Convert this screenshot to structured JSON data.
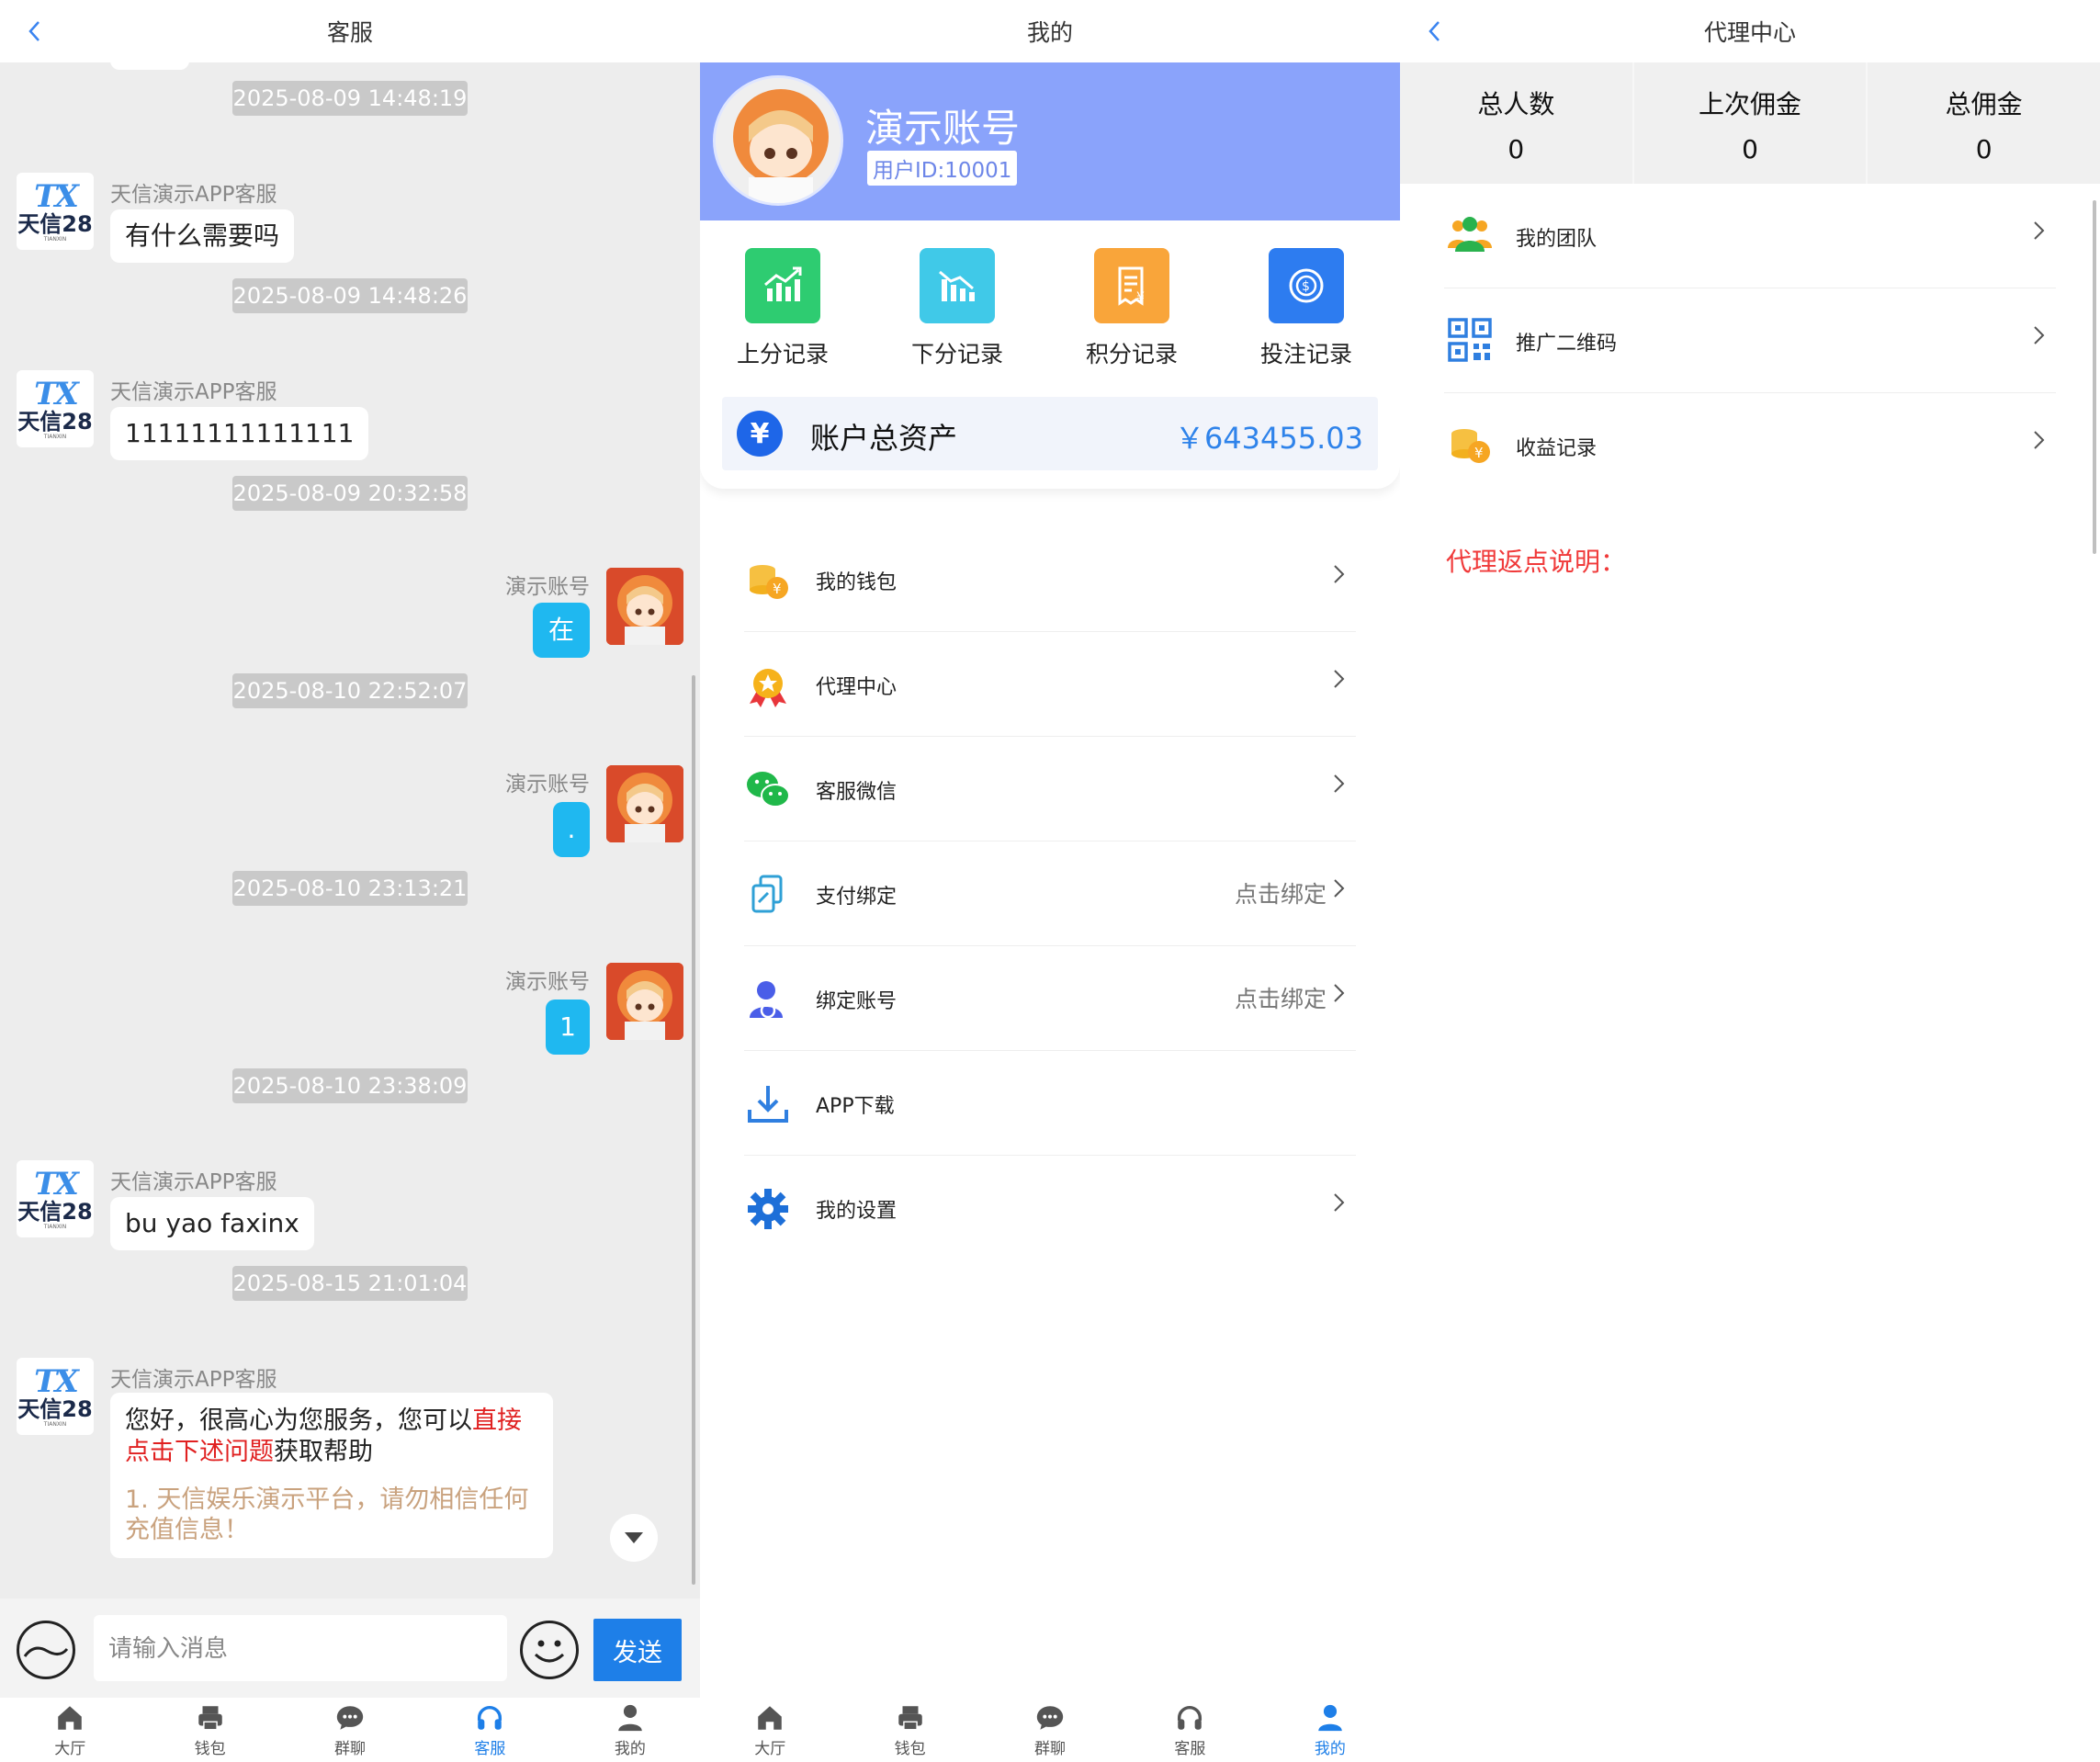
{
  "chat": {
    "title": "客服",
    "service_name": "天信演示APP客服",
    "avatar_tx": "TX",
    "avatar_brand": "天信28",
    "avatar_tiny": "TIANXIN",
    "my_name": "演示账号",
    "timestamps": [
      "2025-08-09 14:48:19",
      "2025-08-09 14:48:26",
      "2025-08-09 20:32:58",
      "2025-08-10 22:52:07",
      "2025-08-10 23:13:21",
      "2025-08-10 23:38:09",
      "2025-08-15 21:01:04"
    ],
    "messages": {
      "m1": "有什么需要吗",
      "m2": "11111111111111",
      "m3": "在",
      "m4": ".",
      "m5": "1",
      "m6": "bu yao faxinx"
    },
    "welcome": {
      "part1": "您好，很高心为您服务，您可以",
      "part_red": "直接点击下述问题",
      "part2": "获取帮助",
      "faq1": "1. 天信娱乐演示平台，请勿相信任何充值信息！"
    },
    "input_placeholder": "请输入消息",
    "send_label": "发送"
  },
  "tabs": [
    "大厅",
    "钱包",
    "群聊",
    "客服",
    "我的"
  ],
  "profile": {
    "title": "我的",
    "user_name": "演示账号",
    "user_id": "用户ID:10001",
    "quick": [
      "上分记录",
      "下分记录",
      "积分记录",
      "投注记录"
    ],
    "asset_label": "账户总资产",
    "asset_value": "￥643455.03",
    "menu": [
      {
        "label": "我的钱包",
        "right": ""
      },
      {
        "label": "代理中心",
        "right": ""
      },
      {
        "label": "客服微信",
        "right": ""
      },
      {
        "label": "支付绑定",
        "right": "点击绑定"
      },
      {
        "label": "绑定账号",
        "right": "点击绑定"
      },
      {
        "label": "APP下载",
        "right": ""
      },
      {
        "label": "我的设置",
        "right": ""
      }
    ]
  },
  "agent": {
    "title": "代理中心",
    "stats": [
      {
        "label": "总人数",
        "value": "0"
      },
      {
        "label": "上次佣金",
        "value": "0"
      },
      {
        "label": "总佣金",
        "value": "0"
      }
    ],
    "menu": [
      "我的团队",
      "推广二维码",
      "收益记录"
    ],
    "note": "代理返点说明："
  },
  "colors": {
    "accent": "#1e7fe8",
    "profile_header": "#8aa3fb",
    "my_bubble": "#1fb8f0",
    "red_text": "#e02020",
    "faq_text": "#c9a27e"
  }
}
